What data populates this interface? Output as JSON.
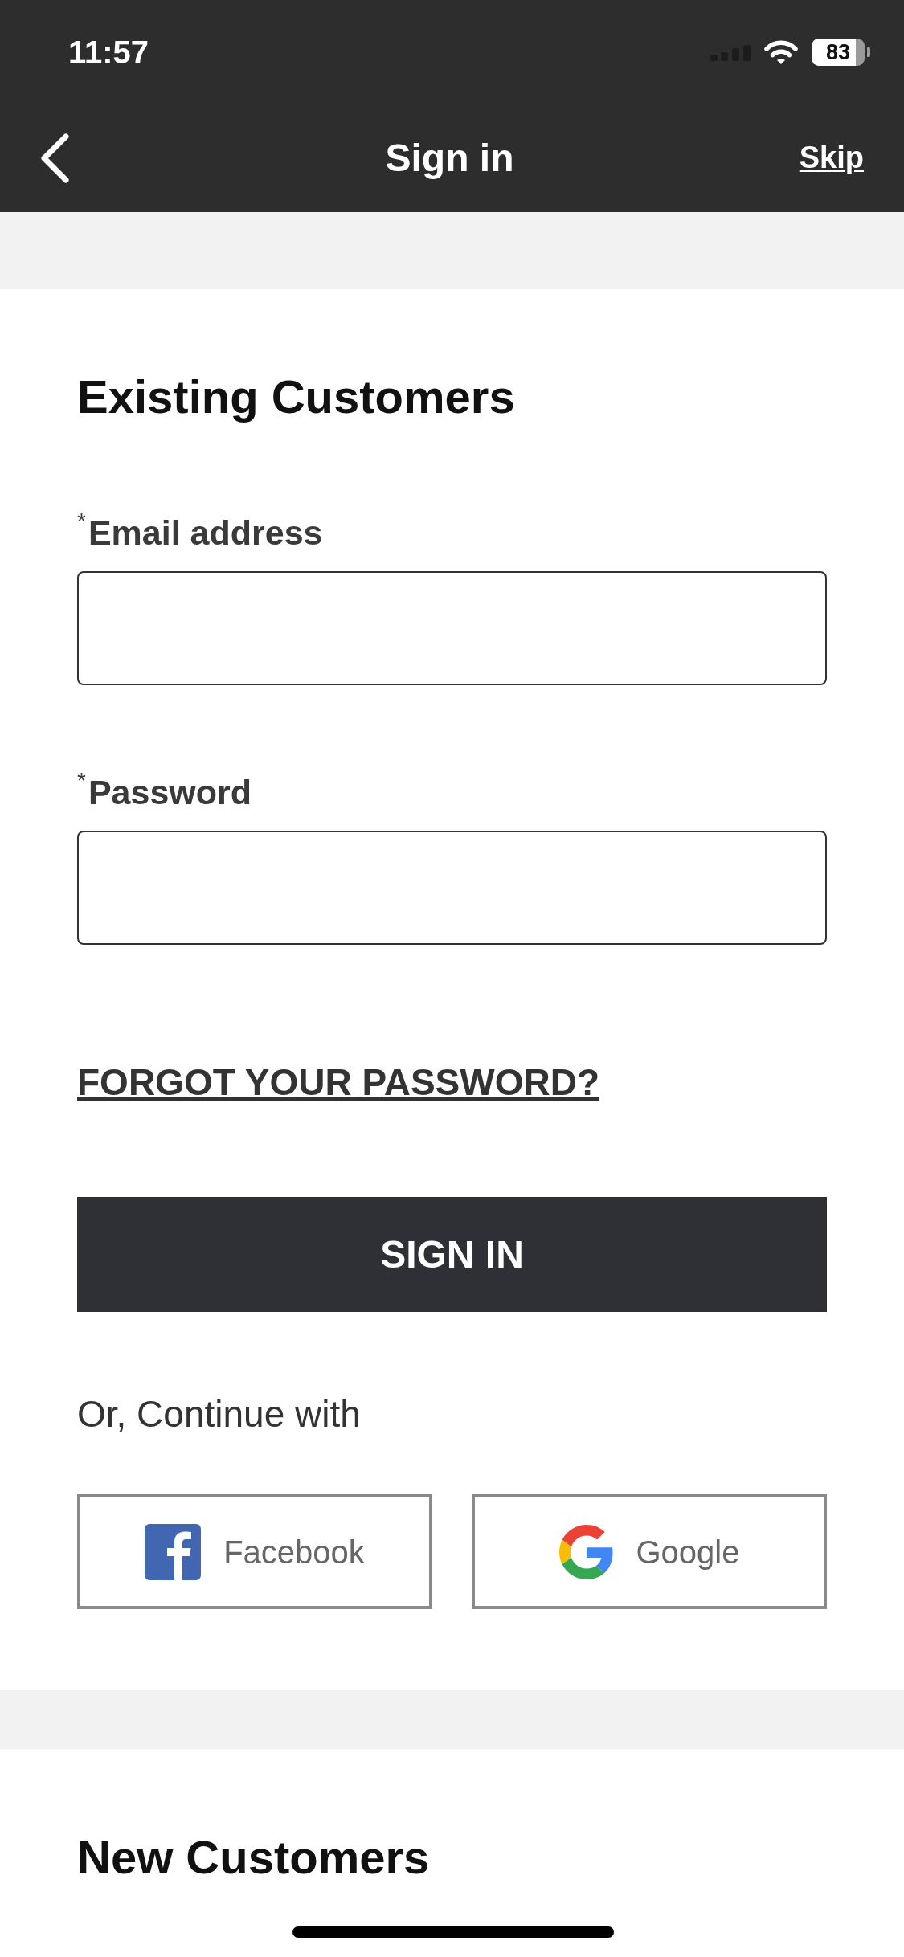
{
  "status_bar": {
    "time": "11:57",
    "battery": "83"
  },
  "nav_bar": {
    "title": "Sign in",
    "action": "Skip"
  },
  "existing_customers": {
    "heading": "Existing Customers",
    "fields": [
      {
        "label": "$^{*}$Email address"
      },
      {
        "label": "$^{*}$Password"
      }
    ],
    "forgot_link": "FORGOT YOUR PASSWORD?",
    "submit": "SIGN IN",
    "alternative_text": "Or, Continue with",
    "social_buttons": [
      {
        "kind": "facebook",
        "label": "Facebook"
      },
      {
        "kind": "google",
        "label": "Google"
      }
    ]
  },
  "new_customers": {
    "heading": "New Customers"
  }
}
